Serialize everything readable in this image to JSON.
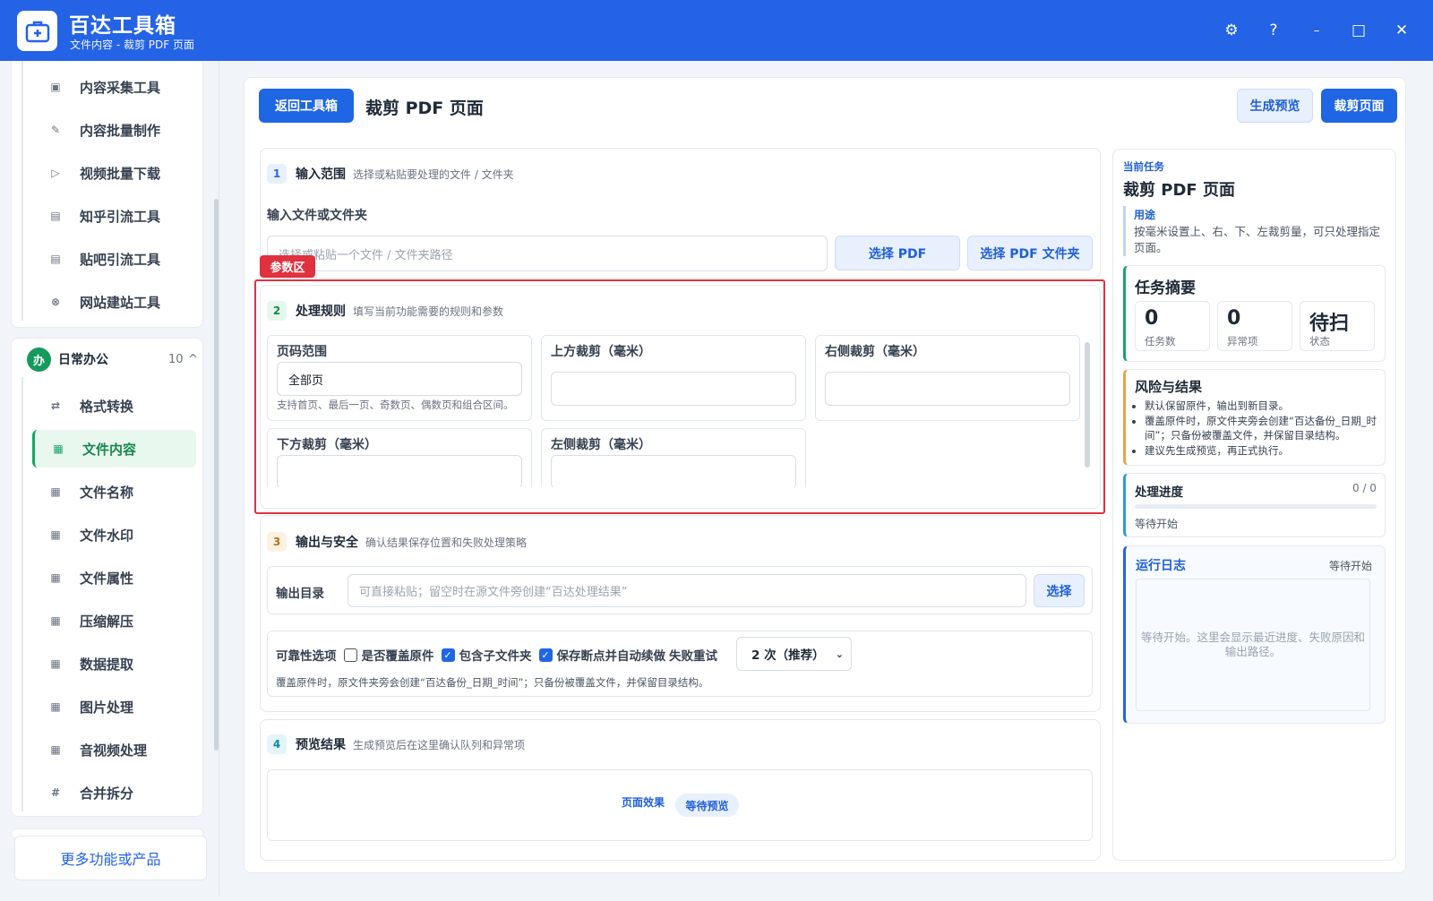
{
  "app": {
    "title": "百达工具箱",
    "subtitle": "文件内容 - 裁剪 PDF 页面"
  },
  "window": {
    "settings": "⚙",
    "help": "?",
    "minimize": "–",
    "maximize": "□",
    "close": "✕"
  },
  "sidebar": {
    "group1_items": [
      {
        "label": "内容采集工具",
        "icon": "▣"
      },
      {
        "label": "内容批量制作",
        "icon": "✎"
      },
      {
        "label": "视频批量下载",
        "icon": "▷"
      },
      {
        "label": "知乎引流工具",
        "icon": "▤"
      },
      {
        "label": "贴吧引流工具",
        "icon": "▤"
      },
      {
        "label": "网站建站工具",
        "icon": "⊗"
      }
    ],
    "group2": {
      "icon_text": "办",
      "name": "日常办公",
      "count": "10",
      "chevron": "^"
    },
    "group2_items": [
      {
        "label": "格式转换",
        "icon": "⇄"
      },
      {
        "label": "文件内容",
        "icon": "▦"
      },
      {
        "label": "文件名称",
        "icon": "▦"
      },
      {
        "label": "文件水印",
        "icon": "▦"
      },
      {
        "label": "文件属性",
        "icon": "▦"
      },
      {
        "label": "压缩解压",
        "icon": "▦"
      },
      {
        "label": "数据提取",
        "icon": "▦"
      },
      {
        "label": "图片处理",
        "icon": "▦"
      },
      {
        "label": "音视频处理",
        "icon": "▦"
      },
      {
        "label": "合并拆分",
        "icon": "#"
      }
    ],
    "more": "更多功能或产品"
  },
  "header": {
    "back": "返回工具箱",
    "title": "裁剪 PDF 页面",
    "preview": "生成预览",
    "run": "裁剪页面"
  },
  "section1": {
    "num": "1",
    "title": "输入范围",
    "desc": "选择或粘贴要处理的文件 / 文件夹",
    "field_label": "输入文件或文件夹",
    "placeholder": "选择或粘贴一个文件 / 文件夹路径",
    "btn_pdf": "选择 PDF",
    "btn_folder": "选择 PDF 文件夹"
  },
  "param_tag": "参数区",
  "section2": {
    "num": "2",
    "title": "处理规则",
    "desc": "填写当前功能需要的规则和参数",
    "fields": [
      {
        "label": "页码范围",
        "value": "全部页",
        "help": "支持首页、最后一页、奇数页、偶数页和组合区间。"
      },
      {
        "label": "上方裁剪（毫米）",
        "value": ""
      },
      {
        "label": "右侧裁剪（毫米）",
        "value": ""
      },
      {
        "label": "下方裁剪（毫米）",
        "value": ""
      },
      {
        "label": "左侧裁剪（毫米）",
        "value": ""
      }
    ]
  },
  "section3": {
    "num": "3",
    "title": "输出与安全",
    "desc": "确认结果保存位置和失败处理策略",
    "out_label": "输出目录",
    "out_placeholder": "可直接粘贴；留空时在源文件旁创建“百达处理结果”",
    "out_btn": "选择",
    "rel_label": "可靠性选项",
    "opt_overwrite": "是否覆盖原件",
    "opt_subfolder": "包含子文件夹",
    "opt_resume": "保存断点并自动续做",
    "retry_label": "失败重试",
    "retry_value": "2 次（推荐）",
    "note": "覆盖原件时，原文件夹旁会创建“百达备份_日期_时间”；只备份被覆盖文件，并保留目录结构。"
  },
  "section4": {
    "num": "4",
    "title": "预览结果",
    "desc": "生成预览后在这里确认队列和异常项",
    "effect_label": "页面效果",
    "badge": "等待预览"
  },
  "right": {
    "current_label": "当前任务",
    "task_title": "裁剪 PDF 页面",
    "usage_label": "用途",
    "usage_text": "按毫米设置上、右、下、左裁剪量，可只处理指定页面。",
    "summary_title": "任务摘要",
    "stats": [
      {
        "value": "0",
        "label": "任务数"
      },
      {
        "value": "0",
        "label": "异常项"
      },
      {
        "value": "待扫",
        "label": "状态"
      }
    ],
    "risk_title": "风险与结果",
    "risk_items": [
      "默认保留原件，输出到新目录。",
      "覆盖原件时，原文件夹旁会创建“百达备份_日期_时间”；只备份被覆盖文件，并保留目录结构。",
      "建议先生成预览，再正式执行。"
    ],
    "progress_title": "处理进度",
    "progress_count": "0 / 0",
    "progress_fraction": 0,
    "progress_status": "等待开始",
    "log_title": "运行日志",
    "log_status": "等待开始",
    "log_text": "等待开始。这里会显示最近进度、失败原因和输出路径。"
  },
  "colors": {
    "primary": "#2463e6",
    "accent_green": "#17a566",
    "highlight_red": "#e0313e"
  }
}
